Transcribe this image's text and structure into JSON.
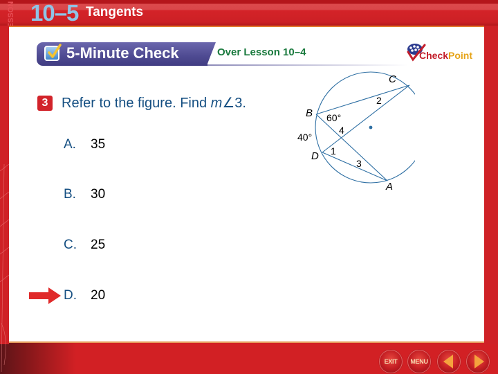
{
  "header": {
    "lesson_word": "LESSON",
    "lesson_number": "10–5",
    "lesson_title": "Tangents"
  },
  "check_bar": {
    "icon": "checkbox-check-icon",
    "title": "5-Minute Check",
    "subtitle": "Over Lesson 10–4"
  },
  "logo": {
    "icon": "checkpoint-logo-icon",
    "part1": "Check",
    "part2": "Point"
  },
  "question": {
    "number": "3",
    "text_before": "Refer to the figure. Find ",
    "math_var": "m",
    "angle_symbol": "∠",
    "text_after": "3."
  },
  "choices": [
    {
      "letter": "A.",
      "value": "35",
      "selected": false
    },
    {
      "letter": "B.",
      "value": "30",
      "selected": false
    },
    {
      "letter": "C.",
      "value": "25",
      "selected": false
    },
    {
      "letter": "D.",
      "value": "20",
      "selected": true
    }
  ],
  "figure": {
    "points": [
      "A",
      "B",
      "C",
      "D"
    ],
    "angle_labels": [
      "1",
      "2",
      "3",
      "4"
    ],
    "arc_label": "40°",
    "angle_given": "60°"
  },
  "nav": {
    "exit_label": "EXIT",
    "menu_label": "MENU",
    "prev_icon": "triangle-left-icon",
    "next_icon": "triangle-right-icon"
  },
  "colors": {
    "brand_red": "#d22024",
    "check_bar_purple": "#4e4a91",
    "question_blue": "#154f82",
    "lesson_green": "#1a7a3e",
    "lesson_number_blue": "#8fc3e6"
  }
}
